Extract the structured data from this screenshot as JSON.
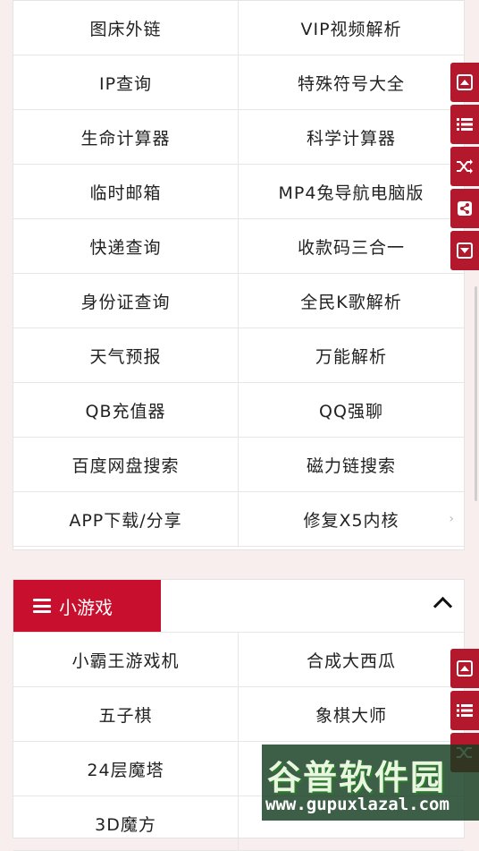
{
  "tools": {
    "items": [
      "图床外链",
      "VIP视频解析",
      "IP查询",
      "特殊符号大全",
      "生命计算器",
      "科学计算器",
      "临时邮箱",
      "MP4兔导航电脑版",
      "快递查询",
      "收款码三合一",
      "身份证查询",
      "全民K歌解析",
      "天气预报",
      "万能解析",
      "QB充值器",
      "QQ强聊",
      "百度网盘搜索",
      "磁力链搜索",
      "APP下载/分享",
      "修复X5内核"
    ],
    "more_arrow": "›"
  },
  "games": {
    "header_label": "小游戏",
    "items": [
      "小霸王游戏机",
      "合成大西瓜",
      "五子棋",
      "象棋大师",
      "24层魔塔",
      "",
      "3D魔方",
      ""
    ]
  },
  "watermark": {
    "title": "谷普软件园",
    "url": "www.gupuxlazal.com"
  },
  "colors": {
    "accent": "#c8102e",
    "float_button": "#b4182c",
    "background": "#f8eeee"
  }
}
